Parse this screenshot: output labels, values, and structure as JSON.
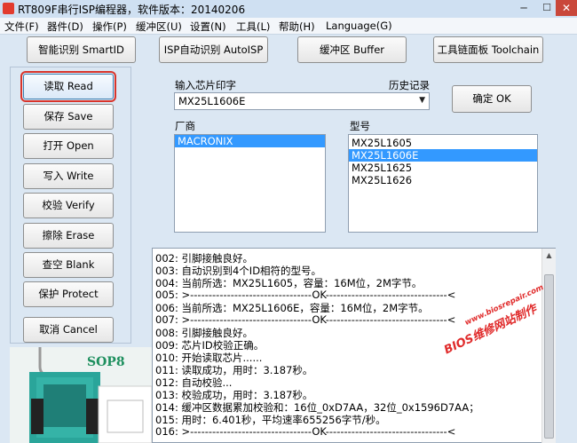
{
  "window": {
    "title": "RT809F串行ISP编程器，软件版本：20140206",
    "min_glyph": "─",
    "max_glyph": "☐",
    "close_glyph": "✕"
  },
  "menu": [
    "文件(F)",
    "器件(D)",
    "操作(P)",
    "缓冲区(U)",
    "设置(N)",
    "工具(L)",
    "帮助(H)",
    "Language(G)"
  ],
  "toolbar": {
    "smartid": "智能识别 SmartID",
    "autoisp": "ISP自动识别 AutoISP",
    "buffer": "缓冲区 Buffer",
    "toolchain": "工具链面板 Toolchain"
  },
  "side_buttons": {
    "read": "读取 Read",
    "save": "保存 Save",
    "open": "打开 Open",
    "write": "写入 Write",
    "verify": "校验 Verify",
    "erase": "擦除 Erase",
    "blank": "查空 Blank",
    "protect": "保护 Protect",
    "cancel": "取消 Cancel"
  },
  "chip": {
    "input_label": "输入芯片印字",
    "history_label": "历史记录",
    "input_value": "MX25L1606E",
    "ok_label": "确定 OK"
  },
  "vendor": {
    "label": "厂商",
    "items": [
      "MACRONIX"
    ]
  },
  "model": {
    "label": "型号",
    "items": [
      "MX25L1605",
      "MX25L1606E",
      "MX25L1625",
      "MX25L1626"
    ]
  },
  "log": [
    "002: 引脚接触良好。",
    "003: 自动识别到4个ID相符的型号。",
    "004: 当前所选：MX25L1605，容量：16M位，2M字节。",
    "005: >---------------------------------OK---------------------------------<",
    "006: 当前所选：MX25L1606E，容量：16M位，2M字节。",
    "007: >---------------------------------OK---------------------------------<",
    "008: 引脚接触良好。",
    "009: 芯片ID校验正确。",
    "010: 开始读取芯片......",
    "011: 读取成功，用时：3.187秒。",
    "012: 自动校验...",
    "013: 校验成功，用时：3.187秒。",
    "014: 缓冲区数据累加校验和：16位_0xD7AA，32位_0x1596D7AA；",
    "015: 用时：6.401秒，平均速率655256字节/秒。",
    "016: >---------------------------------OK---------------------------------<"
  ],
  "device": {
    "package_label": "SOP8"
  },
  "watermark": {
    "url": "www.biosrepair.com",
    "brand": "BIOS维修网站制作"
  },
  "colors": {
    "selection": "#3399ff",
    "highlight_border": "#d9342b",
    "socket_teal": "#2aa59a"
  }
}
